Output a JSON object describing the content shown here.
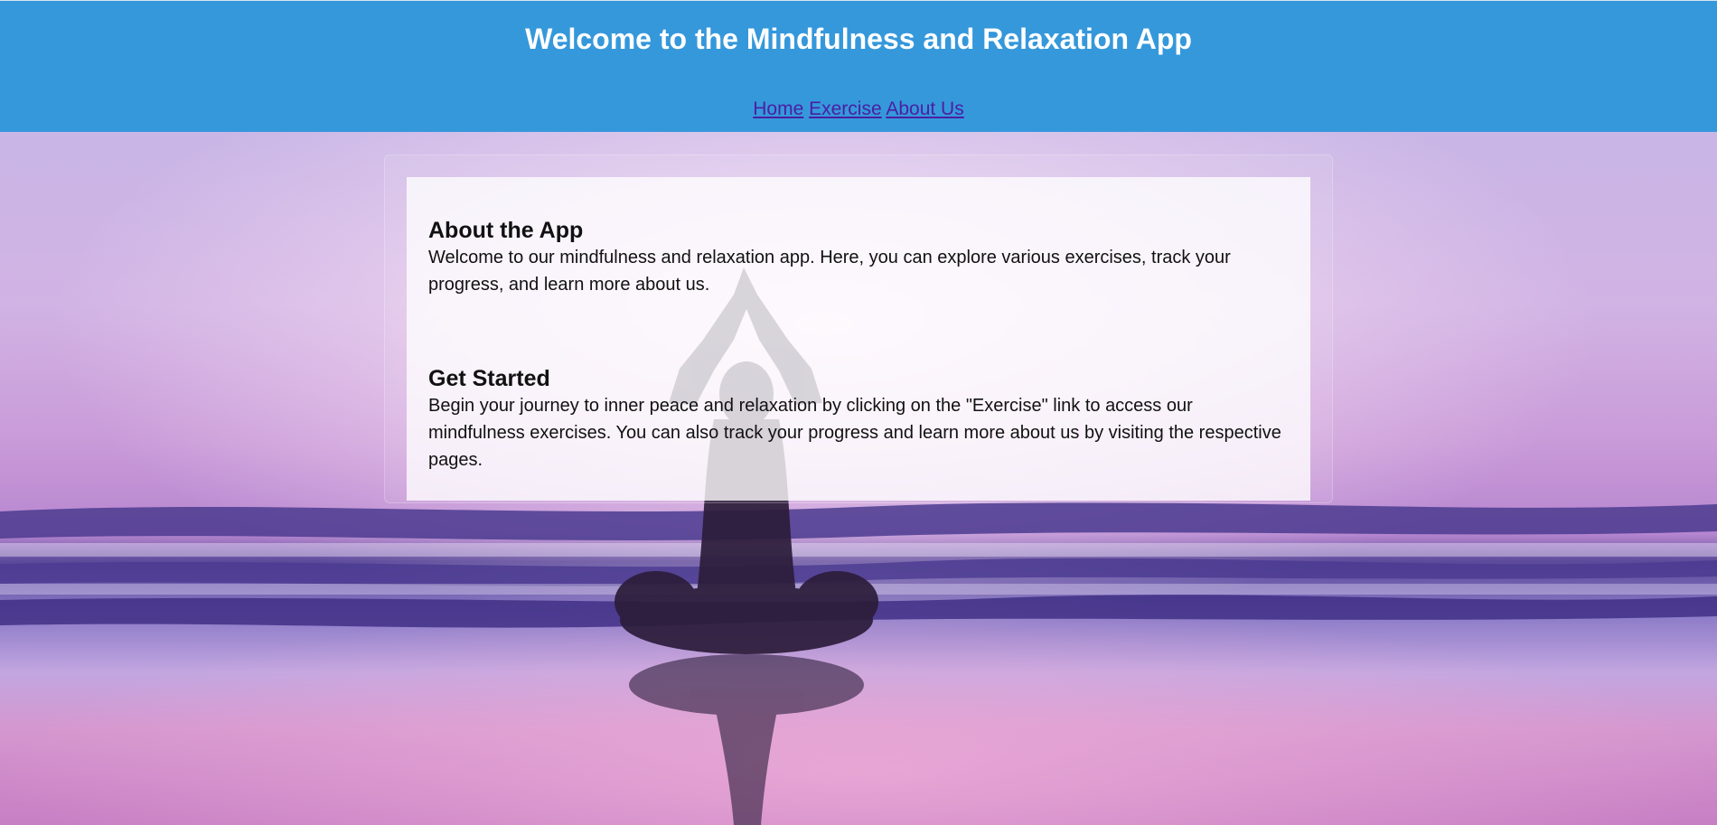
{
  "header": {
    "title": "Welcome to the Mindfulness and Relaxation App",
    "background_color": "#3598db"
  },
  "nav": {
    "links": [
      {
        "label": "Home"
      },
      {
        "label": "Exercise"
      },
      {
        "label": "About Us"
      }
    ],
    "link_color": "#4a1fa3"
  },
  "background": {
    "image": "silhouette-of-person-meditating-on-beach-at-sunset",
    "tone": "purple-pink"
  },
  "main": {
    "sections": [
      {
        "heading": "About the App",
        "body": "Welcome to our mindfulness and relaxation app. Here, you can explore various exercises, track your progress, and learn more about us."
      },
      {
        "heading": "Get Started",
        "body": "Begin your journey to inner peace and relaxation by clicking on the \"Exercise\" link to access our mindfulness exercises. You can also track your progress and learn more about us by visiting the respective pages."
      }
    ]
  }
}
